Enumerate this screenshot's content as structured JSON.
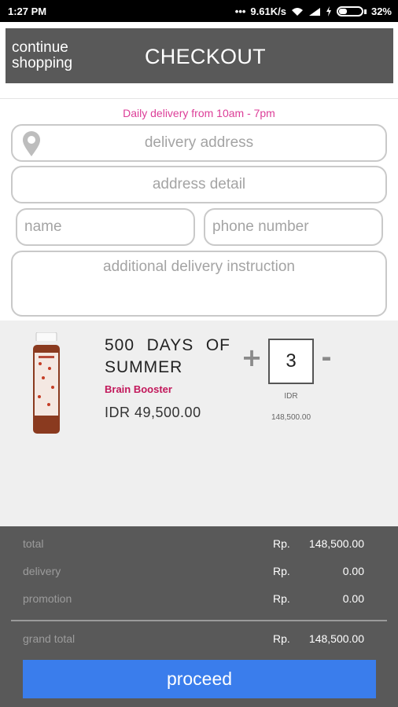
{
  "status_bar": {
    "time": "1:27 PM",
    "network_speed": "9.61K/s",
    "battery": "32%"
  },
  "header": {
    "continue_line1": "continue",
    "continue_line2": "shopping",
    "title": "CHECKOUT"
  },
  "delivery_notice": "Daily delivery from 10am - 7pm",
  "form": {
    "delivery_address_placeholder": "delivery address",
    "address_detail_placeholder": "address detail",
    "name_placeholder": "name",
    "phone_placeholder": "phone number",
    "instruction_placeholder": "additional delivery instruction"
  },
  "cart_item": {
    "name_line1": "500 DAYS OF",
    "name_line2": "SUMMER",
    "category": "Brain Booster",
    "unit_price": "IDR 49,500.00",
    "quantity": "3",
    "increment": "+",
    "decrement": "-",
    "line_currency": "IDR",
    "line_total": "148,500.00",
    "icons": {
      "add": "plus-icon",
      "remove": "minus-icon"
    }
  },
  "summary": {
    "rows": [
      {
        "label": "total",
        "currency": "Rp.",
        "amount": "148,500.00"
      },
      {
        "label": "delivery",
        "currency": "Rp.",
        "amount": "0.00"
      },
      {
        "label": "promotion",
        "currency": "Rp.",
        "amount": "0.00"
      }
    ],
    "grand_total": {
      "label": "grand total",
      "currency": "Rp.",
      "amount": "148,500.00"
    },
    "proceed_label": "proceed"
  },
  "colors": {
    "header_bg": "#595959",
    "accent_pink": "#dc3e98",
    "category_pink": "#c2185b",
    "proceed_blue": "#3a7dec",
    "cart_bg": "#efefef"
  }
}
